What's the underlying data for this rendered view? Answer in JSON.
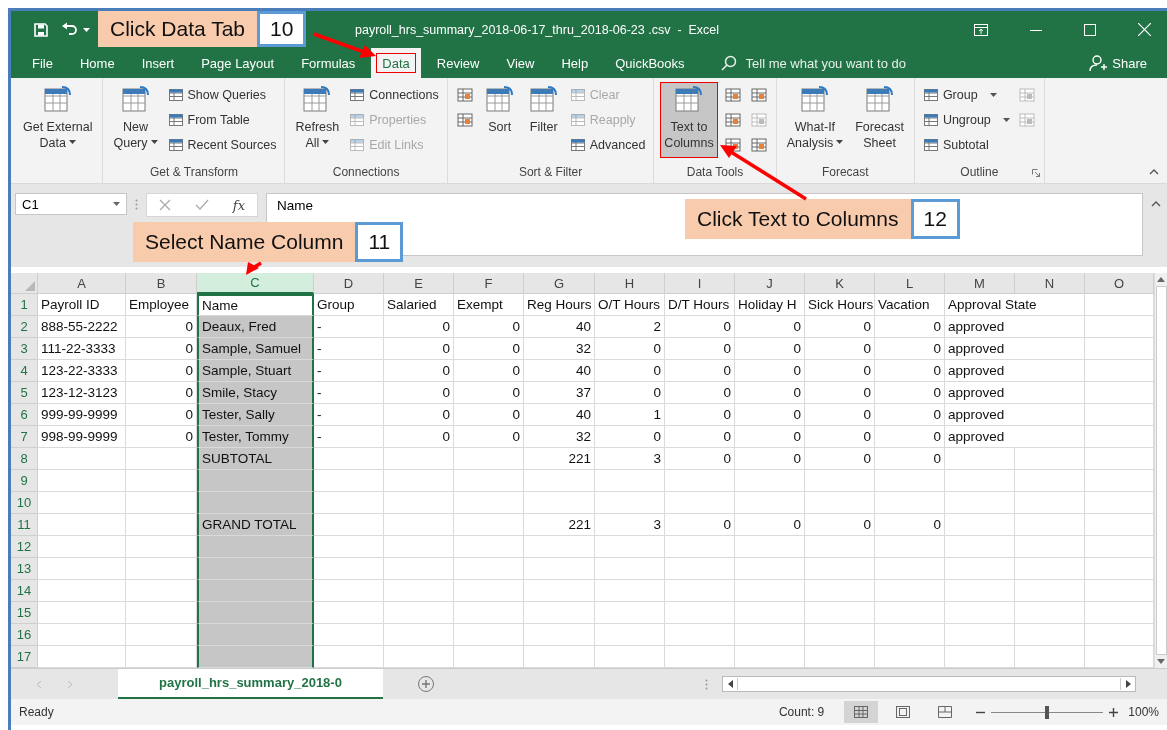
{
  "window": {
    "title": "payroll_hrs_summary_2018-06-17_thru_2018-06-23 .csv  -  Excel"
  },
  "tabs": [
    {
      "label": "File",
      "selected": false,
      "highlighted": false
    },
    {
      "label": "Home",
      "selected": false,
      "highlighted": false
    },
    {
      "label": "Insert",
      "selected": false,
      "highlighted": false
    },
    {
      "label": "Page Layout",
      "selected": false,
      "highlighted": false
    },
    {
      "label": "Formulas",
      "selected": false,
      "highlighted": false
    },
    {
      "label": "Data",
      "selected": true,
      "highlighted": true
    },
    {
      "label": "Review",
      "selected": false,
      "highlighted": false
    },
    {
      "label": "View",
      "selected": false,
      "highlighted": false
    },
    {
      "label": "Help",
      "selected": false,
      "highlighted": false
    },
    {
      "label": "QuickBooks",
      "selected": false,
      "highlighted": false
    }
  ],
  "tell_me": {
    "placeholder": "Tell me what you want to do"
  },
  "share": "Share",
  "ribbon": [
    {
      "items": [
        {
          "kind": "large",
          "lines": [
            "Get External",
            "Data"
          ],
          "dropdown": true,
          "disabled": false,
          "highlighted": false
        }
      ]
    },
    {
      "label": "Get & Transform",
      "items": [
        {
          "kind": "large",
          "lines": [
            "New",
            "Query"
          ],
          "dropdown": true,
          "disabled": false,
          "highlighted": false
        },
        {
          "kind": "small",
          "label": "Show Queries",
          "disabled": false,
          "highlighted": false
        },
        {
          "kind": "small",
          "label": "From Table",
          "disabled": false,
          "highlighted": false
        },
        {
          "kind": "small",
          "label": "Recent Sources",
          "disabled": false,
          "highlighted": false
        }
      ]
    },
    {
      "label": "Connections",
      "items": [
        {
          "kind": "large",
          "lines": [
            "Refresh",
            "All"
          ],
          "dropdown": true,
          "disabled": false,
          "highlighted": false
        },
        {
          "kind": "small",
          "label": "Connections",
          "disabled": false,
          "highlighted": false
        },
        {
          "kind": "small",
          "label": "Properties",
          "disabled": true,
          "highlighted": false
        },
        {
          "kind": "small",
          "label": "Edit Links",
          "disabled": true,
          "highlighted": false
        }
      ]
    },
    {
      "label": "Sort & Filter",
      "items": [
        {
          "kind": "icon",
          "disabled": false,
          "highlighted": false
        },
        {
          "kind": "icon",
          "disabled": false,
          "highlighted": false
        },
        {
          "kind": "large",
          "lines": [
            "Sort"
          ],
          "dropdown": false,
          "disabled": false,
          "highlighted": false
        },
        {
          "kind": "large",
          "lines": [
            "Filter"
          ],
          "dropdown": false,
          "disabled": false,
          "highlighted": false
        },
        {
          "kind": "small",
          "label": "Clear",
          "disabled": true,
          "highlighted": false
        },
        {
          "kind": "small",
          "label": "Reapply",
          "disabled": true,
          "highlighted": false
        },
        {
          "kind": "small",
          "label": "Advanced",
          "disabled": false,
          "highlighted": false
        }
      ]
    },
    {
      "label": "Data Tools",
      "items": [
        {
          "kind": "large",
          "lines": [
            "Text to",
            "Columns"
          ],
          "dropdown": false,
          "disabled": false,
          "highlighted": true
        },
        {
          "kind": "icon",
          "disabled": false,
          "highlighted": false
        },
        {
          "kind": "icon",
          "disabled": false,
          "highlighted": false
        },
        {
          "kind": "icon",
          "disabled": false,
          "highlighted": false
        },
        {
          "kind": "icon",
          "disabled": false,
          "highlighted": false
        },
        {
          "kind": "icon",
          "disabled": true,
          "highlighted": false
        },
        {
          "kind": "icon",
          "disabled": false,
          "highlighted": false
        }
      ]
    },
    {
      "label": "Forecast",
      "items": [
        {
          "kind": "large",
          "lines": [
            "What-If",
            "Analysis"
          ],
          "dropdown": true,
          "disabled": false,
          "highlighted": false
        },
        {
          "kind": "large",
          "lines": [
            "Forecast",
            "Sheet"
          ],
          "dropdown": false,
          "disabled": false,
          "highlighted": false
        }
      ]
    },
    {
      "label": "Outline",
      "launcher": true,
      "items": [
        {
          "kind": "small",
          "label": "Group",
          "dropdown": true,
          "disabled": false,
          "highlighted": false
        },
        {
          "kind": "small",
          "label": "Ungroup",
          "dropdown": true,
          "disabled": false,
          "highlighted": false
        },
        {
          "kind": "small",
          "label": "Subtotal",
          "dropdown": false,
          "disabled": false,
          "highlighted": false
        },
        {
          "kind": "icon",
          "disabled": true,
          "highlighted": false
        },
        {
          "kind": "icon",
          "disabled": true,
          "highlighted": false
        }
      ]
    }
  ],
  "name_box": "C1",
  "function_label": "fx",
  "formula": "Name",
  "columns": [
    {
      "letter": "A",
      "kind": "text",
      "selected": false
    },
    {
      "letter": "B",
      "kind": "number",
      "selected": false
    },
    {
      "letter": "C",
      "kind": "text",
      "selected": true
    },
    {
      "letter": "D",
      "kind": "text",
      "selected": false
    },
    {
      "letter": "E",
      "kind": "number",
      "selected": false
    },
    {
      "letter": "F",
      "kind": "number",
      "selected": false
    },
    {
      "letter": "G",
      "kind": "number",
      "selected": false
    },
    {
      "letter": "H",
      "kind": "number",
      "selected": false
    },
    {
      "letter": "I",
      "kind": "number",
      "selected": false
    },
    {
      "letter": "J",
      "kind": "number",
      "selected": false
    },
    {
      "letter": "K",
      "kind": "number",
      "selected": false
    },
    {
      "letter": "L",
      "kind": "number",
      "selected": false
    },
    {
      "letter": "M",
      "kind": "text",
      "selected": false
    },
    {
      "letter": "N",
      "kind": "text",
      "selected": false
    },
    {
      "letter": "O",
      "kind": "text",
      "selected": false
    }
  ],
  "rows": [
    {
      "num": "1",
      "kind": "header",
      "active": true,
      "cells": [
        "Payroll ID",
        "Employee",
        "Name",
        "Group",
        "Salaried",
        "Exempt",
        "Reg Hours",
        "O/T Hours",
        "D/T Hours",
        "Holiday H",
        "Sick Hours",
        "Vacation",
        "Approval State",
        null,
        null
      ]
    },
    {
      "num": "2",
      "kind": "data",
      "active": false,
      "cells": [
        "888-55-2222",
        "0",
        "Deaux, Fred",
        "-",
        "0",
        "0",
        "40",
        "2",
        "0",
        "0",
        "0",
        "0",
        "approved",
        null,
        null
      ]
    },
    {
      "num": "3",
      "kind": "data",
      "active": false,
      "cells": [
        "111-22-3333",
        "0",
        "Sample, Samuel",
        "-",
        "0",
        "0",
        "32",
        "0",
        "0",
        "0",
        "0",
        "0",
        "approved",
        null,
        null
      ]
    },
    {
      "num": "4",
      "kind": "data",
      "active": false,
      "cells": [
        "123-22-3333",
        "0",
        "Sample, Stuart",
        "-",
        "0",
        "0",
        "40",
        "0",
        "0",
        "0",
        "0",
        "0",
        "approved",
        null,
        null
      ]
    },
    {
      "num": "5",
      "kind": "data",
      "active": false,
      "cells": [
        "123-12-3123",
        "0",
        "Smile, Stacy",
        "-",
        "0",
        "0",
        "37",
        "0",
        "0",
        "0",
        "0",
        "0",
        "approved",
        null,
        null
      ]
    },
    {
      "num": "6",
      "kind": "data",
      "active": false,
      "cells": [
        "999-99-9999",
        "0",
        "Tester, Sally",
        "-",
        "0",
        "0",
        "40",
        "1",
        "0",
        "0",
        "0",
        "0",
        "approved",
        null,
        null
      ]
    },
    {
      "num": "7",
      "kind": "data",
      "active": false,
      "cells": [
        "998-99-9999",
        "0",
        "Tester, Tommy",
        "-",
        "0",
        "0",
        "32",
        "0",
        "0",
        "0",
        "0",
        "0",
        "approved",
        null,
        null
      ]
    },
    {
      "num": "8",
      "kind": "data",
      "active": false,
      "cells": [
        null,
        null,
        "SUBTOTAL",
        null,
        null,
        null,
        "221",
        "3",
        "0",
        "0",
        "0",
        "0",
        null,
        null,
        null
      ]
    },
    {
      "num": "9",
      "kind": "data",
      "active": false
    },
    {
      "num": "10",
      "kind": "data",
      "active": false
    },
    {
      "num": "11",
      "kind": "data",
      "active": false,
      "cells": [
        null,
        null,
        "GRAND TOTAL",
        null,
        null,
        null,
        "221",
        "3",
        "0",
        "0",
        "0",
        "0",
        null,
        null,
        null
      ]
    },
    {
      "num": "12",
      "kind": "data",
      "active": false
    },
    {
      "num": "13",
      "kind": "data",
      "active": false
    },
    {
      "num": "14",
      "kind": "data",
      "active": false
    },
    {
      "num": "15",
      "kind": "data",
      "active": false
    },
    {
      "num": "16",
      "kind": "data",
      "active": false
    },
    {
      "num": "17",
      "kind": "data",
      "active": false
    }
  ],
  "sheet_tabs": [
    {
      "label": "payroll_hrs_summary_2018-0",
      "selected": true
    }
  ],
  "status": {
    "text": "Ready",
    "count": "Count: 9",
    "views": [
      {
        "kind": "normal",
        "selected": true
      },
      {
        "kind": "page-layout",
        "selected": false
      },
      {
        "kind": "page-break",
        "selected": false
      }
    ],
    "zoom": {
      "level": 0.5,
      "reading": "100%"
    }
  },
  "callouts": [
    {
      "text": "Click Data Tab",
      "number": "10"
    },
    {
      "text": "Select Name Column",
      "number": "11"
    },
    {
      "text": "Click Text to Columns",
      "number": "12"
    }
  ]
}
